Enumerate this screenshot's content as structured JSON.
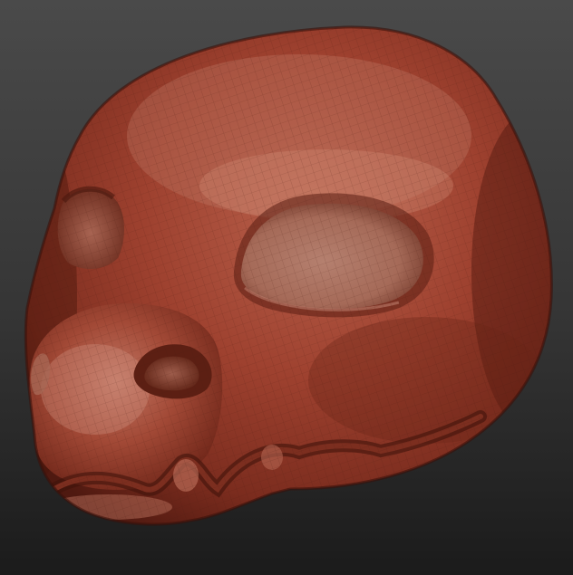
{
  "viewport": {
    "background_top": "#454545",
    "background_bottom": "#1c1c1c",
    "subject": "sculpted-head-mesh"
  },
  "material": {
    "base": "#9c3f2d",
    "highlight": "#c87d6a",
    "shadow": "#4a1a10",
    "wire": "#6e2a1c"
  }
}
